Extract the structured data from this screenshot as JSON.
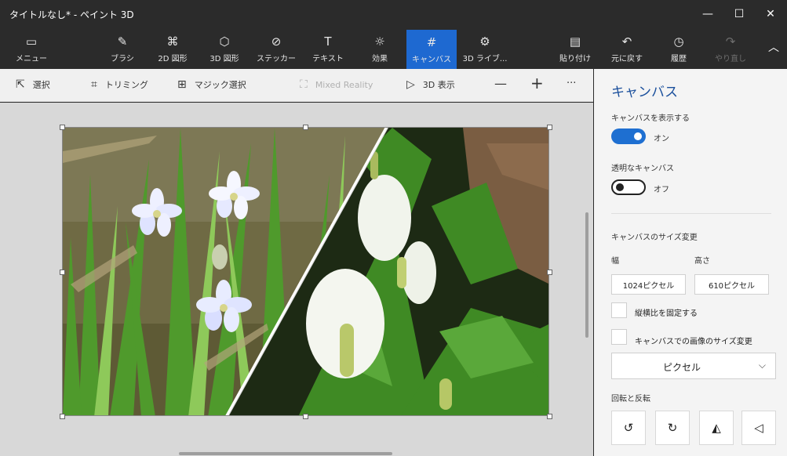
{
  "window": {
    "title": "タイトルなし* - ペイント 3D",
    "min_icon": "—",
    "max_icon": "☐",
    "close_icon": "✕"
  },
  "ribbon": {
    "menu": {
      "label": "メニュー",
      "icon": "▭"
    },
    "brush": {
      "label": "ブラシ",
      "icon": "✎"
    },
    "shapes2d": {
      "label": "2D 図形",
      "icon": "⌘"
    },
    "shapes3d": {
      "label": "3D 図形",
      "icon": "⬡"
    },
    "stickers": {
      "label": "ステッカー",
      "icon": "⊘"
    },
    "text": {
      "label": "テキスト",
      "icon": "T"
    },
    "effects": {
      "label": "効果",
      "icon": "☼"
    },
    "canvas": {
      "label": "キャンバス",
      "icon": "#"
    },
    "library3d": {
      "label": "3D ライブ...",
      "icon": "⚙"
    },
    "paste": {
      "label": "貼り付け",
      "icon": "▤"
    },
    "undo": {
      "label": "元に戻す",
      "icon": "↶"
    },
    "history": {
      "label": "履歴",
      "icon": "◷"
    },
    "redo": {
      "label": "やり直し",
      "icon": "↷"
    },
    "collapse_icon": "︿"
  },
  "toolbar": {
    "select": {
      "label": "選択",
      "icon": "⇱"
    },
    "crop": {
      "label": "トリミング",
      "icon": "⌗"
    },
    "magic": {
      "label": "マジック選択",
      "icon": "⊞"
    },
    "mixed": {
      "label": "Mixed Reality",
      "icon": "⛶"
    },
    "view3d": {
      "label": "3D 表示",
      "icon": "▷"
    },
    "zoom_out": "—",
    "zoom_in": "+",
    "more": "···"
  },
  "panel": {
    "title": "キャンバス",
    "show_canvas": {
      "label": "キャンバスを表示する",
      "state": "オン"
    },
    "transparent": {
      "label": "透明なキャンバス",
      "state": "オフ"
    },
    "resize_title": "キャンバスのサイズ変更",
    "width_label": "幅",
    "height_label": "高さ",
    "width_value": "1024ピクセル",
    "height_value": "610ピクセル",
    "lock_ratio": "縦横比を固定する",
    "resize_image": "キャンバスでの画像のサイズ変更",
    "unit": "ピクセル",
    "unit_chevron": "⌵",
    "rotate_title": "回転と反転",
    "rotate_left_icon": "↺",
    "rotate_right_icon": "↻",
    "flip_h_icon": "◭",
    "flip_v_icon": "◁"
  }
}
